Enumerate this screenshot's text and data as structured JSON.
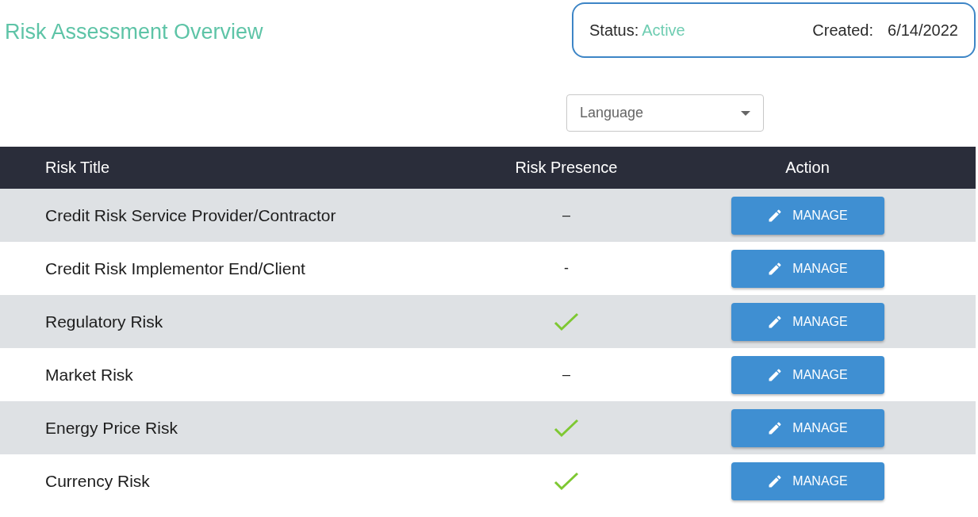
{
  "title": "Risk Assessment Overview",
  "info": {
    "status_label": "Status:",
    "status_value": "Active",
    "created_label": "Created:",
    "created_value": "6/14/2022"
  },
  "language_select": {
    "placeholder": "Language"
  },
  "table": {
    "columns": [
      "Risk Title",
      "Risk Presence",
      "Action"
    ],
    "rows": [
      {
        "title": "Credit Risk Service Provider/Contractor",
        "present": false,
        "mark": "–",
        "action": "MANAGE"
      },
      {
        "title": "Credit Risk Implementor End/Client",
        "present": false,
        "mark": "-",
        "action": "MANAGE"
      },
      {
        "title": "Regulatory Risk",
        "present": true,
        "action": "MANAGE"
      },
      {
        "title": "Market Risk",
        "present": false,
        "mark": "–",
        "action": "MANAGE"
      },
      {
        "title": "Energy Price Risk",
        "present": true,
        "action": "MANAGE"
      },
      {
        "title": "Currency Risk",
        "present": true,
        "action": "MANAGE"
      }
    ]
  }
}
